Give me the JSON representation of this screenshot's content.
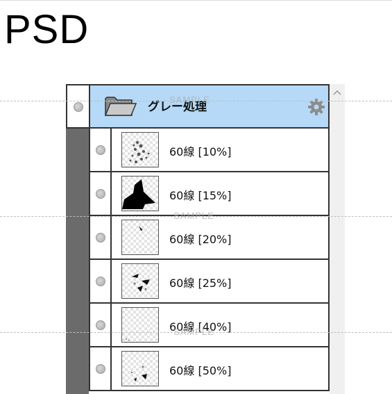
{
  "title": "PSD",
  "watermark": "SAMPLE",
  "folder": {
    "name": "グレー処理"
  },
  "layers": [
    {
      "name": "60線 [10%]"
    },
    {
      "name": "60線 [15%]"
    },
    {
      "name": "60線 [20%]"
    },
    {
      "name": "60線 [25%]"
    },
    {
      "name": "60線 [40%]"
    },
    {
      "name": "60線 [50%]"
    }
  ],
  "icons": {
    "folder": "folder-icon",
    "gear": "gear-icon",
    "visibility": "visibility-dot-icon",
    "scroll_up": "chevron-up-icon"
  },
  "colors": {
    "folder_highlight": "#b5d9f7",
    "gutter": "#6b6b6b",
    "border": "#333333"
  }
}
